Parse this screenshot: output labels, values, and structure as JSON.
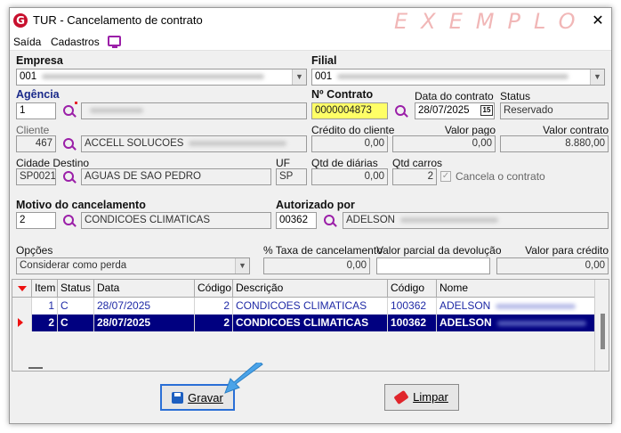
{
  "window": {
    "title": "TUR - Cancelamento de contrato",
    "watermark": "EXEMPLO",
    "close_glyph": "✕"
  },
  "menu": {
    "items": [
      "Saída",
      "Cadastros"
    ],
    "monitor_icon": "monitor-icon"
  },
  "empresa": {
    "label": "Empresa",
    "value": "001"
  },
  "filial": {
    "label": "Filial",
    "value": "001"
  },
  "agencia": {
    "label": "Agência",
    "value": "1"
  },
  "contrato": {
    "label": "Nº Contrato",
    "value": "0000004873"
  },
  "data_contrato": {
    "label": "Data do contrato",
    "value": "28/07/2025",
    "cal_glyph": "15"
  },
  "status": {
    "label": "Status",
    "value": "Reservado"
  },
  "cliente": {
    "label": "Cliente",
    "code": "467",
    "name": "ACCELL SOLUCOES"
  },
  "credito_cliente": {
    "label": "Crédito do cliente",
    "value": "0,00"
  },
  "valor_pago": {
    "label": "Valor pago",
    "value": "0,00"
  },
  "valor_contrato": {
    "label": "Valor contrato",
    "value": "8.880,00"
  },
  "cidade_destino": {
    "label": "Cidade Destino",
    "code": "SP0021",
    "name": "AGUAS DE SAO PEDRO"
  },
  "uf": {
    "label": "UF",
    "value": "SP"
  },
  "qtd_diarias": {
    "label": "Qtd de diárias",
    "value": "0,00"
  },
  "qtd_carros": {
    "label": "Qtd carros",
    "value": "2"
  },
  "cancela_contrato": {
    "label": "Cancela o contrato",
    "checked": true
  },
  "motivo": {
    "label": "Motivo do cancelamento",
    "code": "2",
    "name": "CONDICOES CLIMATICAS"
  },
  "autorizado": {
    "label": "Autorizado por",
    "code": "00362",
    "name": "ADELSON"
  },
  "opcoes": {
    "label": "Opções",
    "value": "Considerar como perda"
  },
  "taxa": {
    "label": "% Taxa de cancelamento",
    "value": "0,00"
  },
  "valor_parcial": {
    "label": "Valor parcial da devolução",
    "value": ""
  },
  "valor_credito": {
    "label": "Valor para crédito",
    "value": "0,00"
  },
  "grid": {
    "columns": [
      "Item",
      "Status",
      "Data",
      "Código",
      "Descrição",
      "Código",
      "Nome"
    ],
    "rows": [
      [
        "1",
        "C",
        "28/07/2025",
        "2",
        "CONDICOES CLIMATICAS",
        "100362",
        "ADELSON"
      ],
      [
        "2",
        "C",
        "28/07/2025",
        "2",
        "CONDICOES CLIMATICAS",
        "100362",
        "ADELSON"
      ]
    ]
  },
  "buttons": {
    "save": "Gravar",
    "clear": "Limpar"
  },
  "colors": {
    "accent": "#9b1fa8",
    "selection": "#000080",
    "contract_highlight": "#ffff66",
    "brand": "#c8102e"
  }
}
